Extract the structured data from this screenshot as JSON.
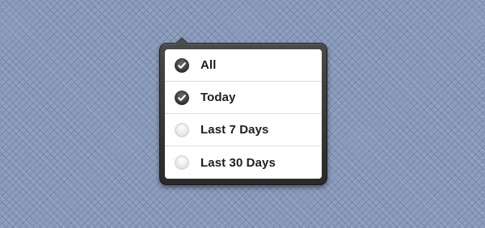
{
  "filter_menu": {
    "items": [
      {
        "label": "All",
        "checked": true,
        "check_icon": "check-icon"
      },
      {
        "label": "Today",
        "checked": true,
        "check_icon": "check-icon"
      },
      {
        "label": "Last 7 Days",
        "checked": false,
        "check_icon": "empty-radio-icon"
      },
      {
        "label": "Last 30 Days",
        "checked": false,
        "check_icon": "empty-radio-icon"
      }
    ]
  },
  "colors": {
    "background": "#8c9dbd",
    "popover_frame": "#333333",
    "checked_fill": "#3e3e3e",
    "unchecked_fill": "#eeeeee",
    "label_text": "#1e1e1e"
  }
}
